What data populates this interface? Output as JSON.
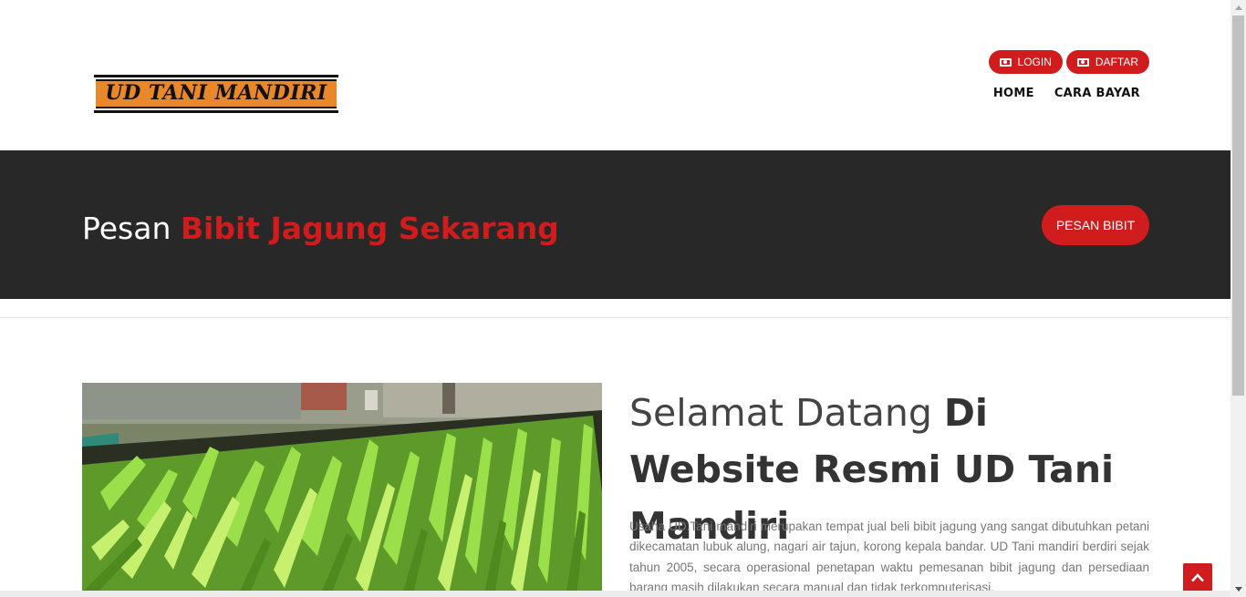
{
  "header": {
    "logo_text": "UD TANI MANDIRI",
    "auth_buttons": [
      {
        "label": "LOGIN",
        "icon": "money-icon"
      },
      {
        "label": "DAFTAR",
        "icon": "money-icon"
      }
    ],
    "nav": [
      {
        "label": "HOME"
      },
      {
        "label": "CARA BAYAR"
      }
    ]
  },
  "banner": {
    "title_prefix": "Pesan ",
    "title_highlight": "Bibit Jagung Sekarang",
    "button_label": "PESAN BIBIT"
  },
  "welcome": {
    "light": "Selamat Datang ",
    "strong": "Di Website Resmi UD Tani Mandiri"
  },
  "about": {
    "text": "Usaha UD.Tani mandiri merupakan tempat jual beli bibit jagung yang sangat dibutuhkan petani dikecamatan lubuk alung, nagari air tajun, korong kepala bandar. UD Tani mandiri berdiri sejak tahun 2005, secara operasional penetapan waktu pemesanan bibit jagung dan persediaan barang masih dilakukan secara manual dan tidak terkomputerisasi."
  },
  "colors": {
    "accent": "#d01c1c",
    "banner_bg": "#282828",
    "logo_orange": "#e8882a"
  },
  "icons": {
    "to_top": "chevron-up-icon"
  }
}
